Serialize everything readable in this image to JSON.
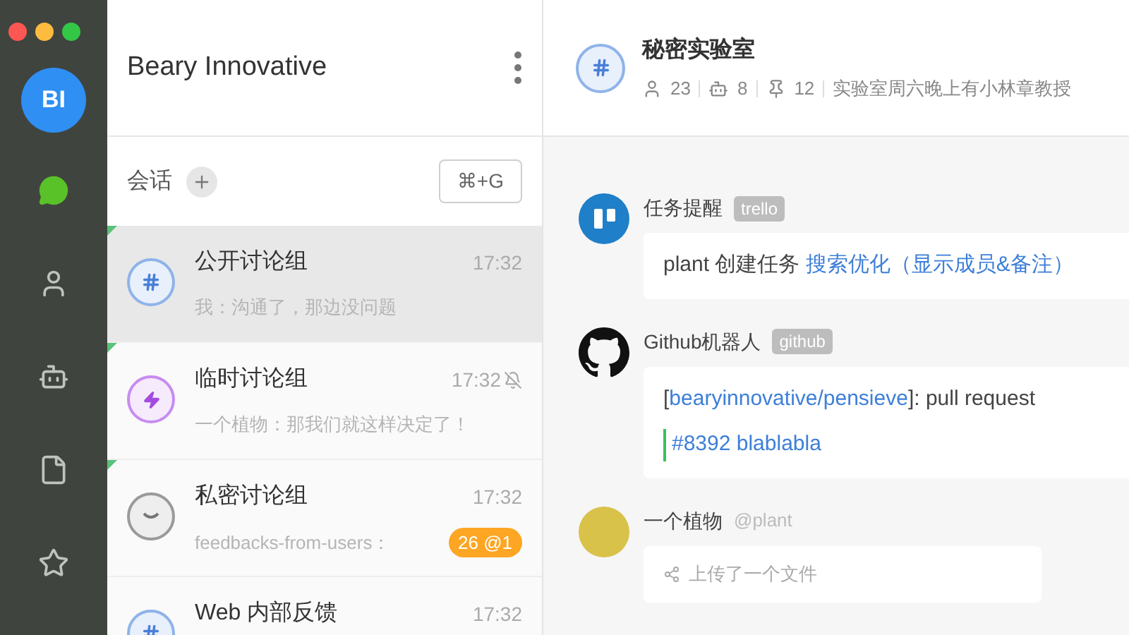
{
  "rail": {
    "avatar": "BI",
    "items": [
      {
        "kind": "chat",
        "selected": true
      },
      {
        "kind": "contacts",
        "selected": false
      },
      {
        "kind": "bot",
        "selected": false
      },
      {
        "kind": "file",
        "selected": false
      },
      {
        "kind": "star",
        "selected": false
      }
    ]
  },
  "team": {
    "name": "Beary Innovative"
  },
  "sessions": {
    "label": "会话",
    "shortcut": "⌘+G"
  },
  "conversations": [
    {
      "kind": "channel",
      "name": "公开讨论组",
      "time": "17:32",
      "preview": "我：沟通了，那边没问题",
      "selected": true,
      "unread": true,
      "muted": false
    },
    {
      "kind": "temporary",
      "name": "临时讨论组",
      "time": "17:32",
      "preview": "一个植物：那我们就这样决定了！",
      "selected": false,
      "unread": true,
      "muted": true
    },
    {
      "kind": "private",
      "name": "私密讨论组",
      "time": "17:32",
      "preview": "feedbacks-from-users：",
      "badge": "26 @1",
      "selected": false,
      "unread": true,
      "muted": false
    },
    {
      "kind": "channel",
      "name": "Web 内部反馈",
      "time": "17:32",
      "selected": false,
      "unread": false,
      "muted": false
    }
  ],
  "channel": {
    "name": "秘密实验室",
    "members": "23",
    "bots": "8",
    "pins": "12",
    "topic": "实验室周六晚上有小林章教授"
  },
  "messages": [
    {
      "kind": "trello",
      "sender": "任务提醒",
      "tag": "trello",
      "lines": [
        [
          {
            "text": "plant 创建任务 ",
            "link": false
          },
          {
            "text": "搜索优化（显示成员&备注）",
            "link": true
          }
        ]
      ]
    },
    {
      "kind": "github",
      "sender": "Github机器人",
      "tag": "github",
      "lines": [
        [
          {
            "text": "[",
            "link": false
          },
          {
            "text": "bearyinnovative/pensieve",
            "link": true
          },
          {
            "text": "]: pull request",
            "link": false
          }
        ],
        [
          {
            "text": "#8392 blablabla",
            "link": true,
            "quote": true
          }
        ]
      ]
    },
    {
      "kind": "user",
      "sender": "一个植物",
      "handle": "@plant",
      "file": "上传了一个文件"
    }
  ]
}
